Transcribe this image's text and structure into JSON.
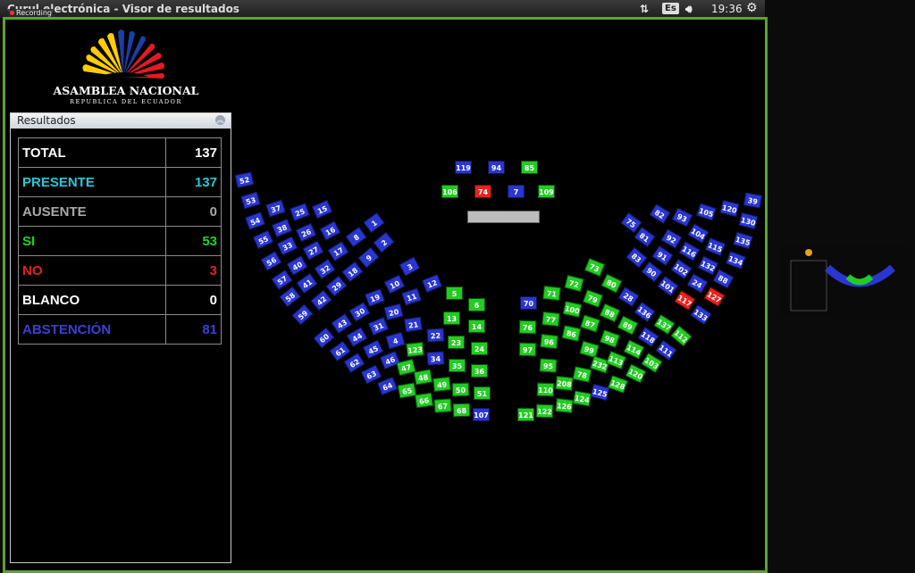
{
  "window": {
    "title": "Curul electrónica - Visor de resultados",
    "recording_label": "Recording",
    "keyboard_layout": "Es",
    "clock": "19:36"
  },
  "logo": {
    "name": "Asamblea Nacional",
    "subtitle": "República del Ecuador",
    "text_line1": "ASAMBLEA NACIONAL",
    "text_line2": "REPUBLICA DEL ECUADOR"
  },
  "panel": {
    "title": "Resultados"
  },
  "results": [
    {
      "label": "TOTAL",
      "value": "137",
      "color": "#ffffff"
    },
    {
      "label": "PRESENTE",
      "value": "137",
      "color": "#27c8d6"
    },
    {
      "label": "AUSENTE",
      "value": "0",
      "color": "#a8a8a8"
    },
    {
      "label": "SI",
      "value": "53",
      "color": "#22d11e"
    },
    {
      "label": "NO",
      "value": "3",
      "color": "#e0241d"
    },
    {
      "label": "BLANCO",
      "value": "0",
      "color": "#ffffff"
    },
    {
      "label": "ABSTENCIÓN",
      "value": "81",
      "color": "#3b3fd8"
    }
  ],
  "colors": {
    "yes": "#22cc22",
    "no": "#e8231c",
    "abstention": "#2a36d0",
    "presidium_gray": "#bcbcbc"
  },
  "seats": [
    [
      "119",
      "a"
    ],
    [
      "94",
      "a"
    ],
    [
      "85",
      "y"
    ],
    [
      "106",
      "y"
    ],
    [
      "74",
      "n"
    ],
    [
      "7",
      "a"
    ],
    [
      "109",
      "y"
    ],
    [
      "52",
      "a"
    ],
    [
      "53",
      "a"
    ],
    [
      "54",
      "a"
    ],
    [
      "55",
      "a"
    ],
    [
      "56",
      "a"
    ],
    [
      "57",
      "a"
    ],
    [
      "58",
      "a"
    ],
    [
      "59",
      "a"
    ],
    [
      "37",
      "a"
    ],
    [
      "38",
      "a"
    ],
    [
      "33",
      "a"
    ],
    [
      "40",
      "a"
    ],
    [
      "41",
      "a"
    ],
    [
      "42",
      "a"
    ],
    [
      "25",
      "a"
    ],
    [
      "26",
      "a"
    ],
    [
      "27",
      "a"
    ],
    [
      "32",
      "a"
    ],
    [
      "29",
      "a"
    ],
    [
      "15",
      "a"
    ],
    [
      "16",
      "a"
    ],
    [
      "17",
      "a"
    ],
    [
      "18",
      "a"
    ],
    [
      "1",
      "a"
    ],
    [
      "8",
      "a"
    ],
    [
      "2",
      "a"
    ],
    [
      "9",
      "a"
    ],
    [
      "3",
      "a"
    ],
    [
      "12",
      "a"
    ],
    [
      "10",
      "a"
    ],
    [
      "11",
      "a"
    ],
    [
      "19",
      "a"
    ],
    [
      "20",
      "a"
    ],
    [
      "21",
      "a"
    ],
    [
      "22",
      "a"
    ],
    [
      "30",
      "a"
    ],
    [
      "31",
      "a"
    ],
    [
      "4",
      "a"
    ],
    [
      "43",
      "a"
    ],
    [
      "44",
      "a"
    ],
    [
      "45",
      "a"
    ],
    [
      "46",
      "a"
    ],
    [
      "60",
      "a"
    ],
    [
      "61",
      "a"
    ],
    [
      "62",
      "a"
    ],
    [
      "63",
      "a"
    ],
    [
      "64",
      "a"
    ],
    [
      "5",
      "y"
    ],
    [
      "6",
      "y"
    ],
    [
      "13",
      "y"
    ],
    [
      "14",
      "y"
    ],
    [
      "23",
      "y"
    ],
    [
      "24",
      "y"
    ],
    [
      "123",
      "y"
    ],
    [
      "34",
      "a"
    ],
    [
      "35",
      "y"
    ],
    [
      "36",
      "y"
    ],
    [
      "47",
      "y"
    ],
    [
      "48",
      "y"
    ],
    [
      "49",
      "y"
    ],
    [
      "50",
      "y"
    ],
    [
      "51",
      "y"
    ],
    [
      "65",
      "y"
    ],
    [
      "66",
      "y"
    ],
    [
      "67",
      "y"
    ],
    [
      "68",
      "y"
    ],
    [
      "107",
      "a"
    ],
    [
      "70",
      "a"
    ],
    [
      "71",
      "y"
    ],
    [
      "72",
      "y"
    ],
    [
      "73",
      "y"
    ],
    [
      "76",
      "y"
    ],
    [
      "77",
      "y"
    ],
    [
      "100",
      "y"
    ],
    [
      "79",
      "y"
    ],
    [
      "80",
      "y"
    ],
    [
      "97",
      "y"
    ],
    [
      "96",
      "y"
    ],
    [
      "86",
      "y"
    ],
    [
      "87",
      "y"
    ],
    [
      "88",
      "y"
    ],
    [
      "95",
      "y"
    ],
    [
      "99",
      "y"
    ],
    [
      "98",
      "y"
    ],
    [
      "89",
      "y"
    ],
    [
      "28",
      "a"
    ],
    [
      "110",
      "y"
    ],
    [
      "208",
      "y"
    ],
    [
      "78",
      "y"
    ],
    [
      "232",
      "y"
    ],
    [
      "113",
      "y"
    ],
    [
      "114",
      "y"
    ],
    [
      "137",
      "y"
    ],
    [
      "136",
      "a"
    ],
    [
      "121",
      "y"
    ],
    [
      "122",
      "y"
    ],
    [
      "126",
      "y"
    ],
    [
      "124",
      "y"
    ],
    [
      "125",
      "a"
    ],
    [
      "128",
      "y"
    ],
    [
      "120",
      "y"
    ],
    [
      "103",
      "y"
    ],
    [
      "111",
      "a"
    ],
    [
      "112",
      "y"
    ],
    [
      "118",
      "a"
    ],
    [
      "75",
      "a"
    ],
    [
      "82",
      "a"
    ],
    [
      "81",
      "a"
    ],
    [
      "83",
      "a"
    ],
    [
      "92",
      "a"
    ],
    [
      "91",
      "a"
    ],
    [
      "90",
      "a"
    ],
    [
      "93",
      "a"
    ],
    [
      "104",
      "a"
    ],
    [
      "116",
      "a"
    ],
    [
      "102",
      "a"
    ],
    [
      "101",
      "a"
    ],
    [
      "24",
      "a"
    ],
    [
      "117",
      "n"
    ],
    [
      "105",
      "a"
    ],
    [
      "115",
      "a"
    ],
    [
      "132",
      "a"
    ],
    [
      "88",
      "a"
    ],
    [
      "127",
      "n"
    ],
    [
      "133",
      "a"
    ],
    [
      "120",
      "a"
    ],
    [
      "130",
      "a"
    ],
    [
      "135",
      "a"
    ],
    [
      "134",
      "a"
    ],
    [
      "39",
      "a"
    ]
  ]
}
